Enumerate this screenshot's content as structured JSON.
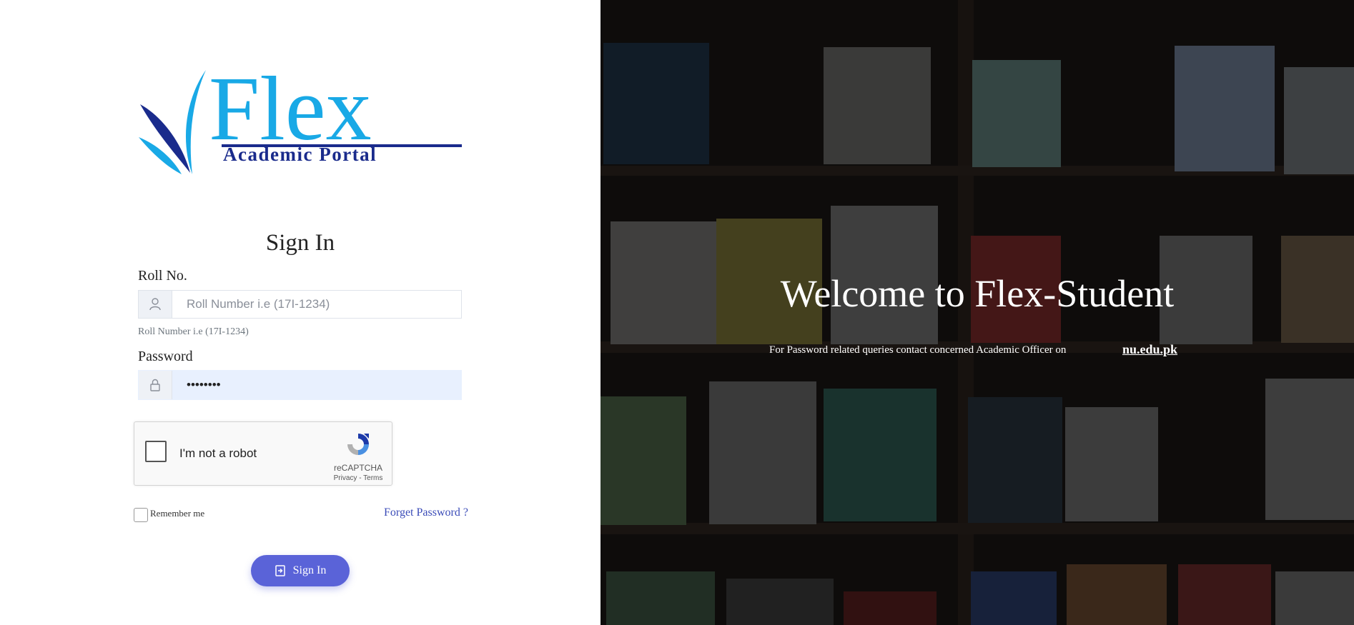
{
  "logo": {
    "title": "Flex",
    "subtitle": "Academic Portal"
  },
  "form": {
    "title": "Sign In",
    "roll_label": "Roll No.",
    "roll_placeholder": "Roll Number i.e (17I-1234)",
    "roll_help": "Roll Number i.e (17I-1234)",
    "password_label": "Password",
    "password_value": "••••••••",
    "remember_label": "Remember me",
    "forgot_label": "Forget Password ?",
    "signin_button": "Sign In"
  },
  "recaptcha": {
    "checkbox_label": "I'm not a robot",
    "brand": "reCAPTCHA",
    "links": "Privacy - Terms"
  },
  "hero": {
    "welcome": "Welcome to Flex-Student",
    "note": "For Password related queries contact concerned Academic Officer on",
    "link": "nu.edu.pk"
  },
  "colors": {
    "accent": "#5a63d8",
    "logo_blue": "#19a9e6",
    "logo_navy": "#1a2b8c"
  }
}
